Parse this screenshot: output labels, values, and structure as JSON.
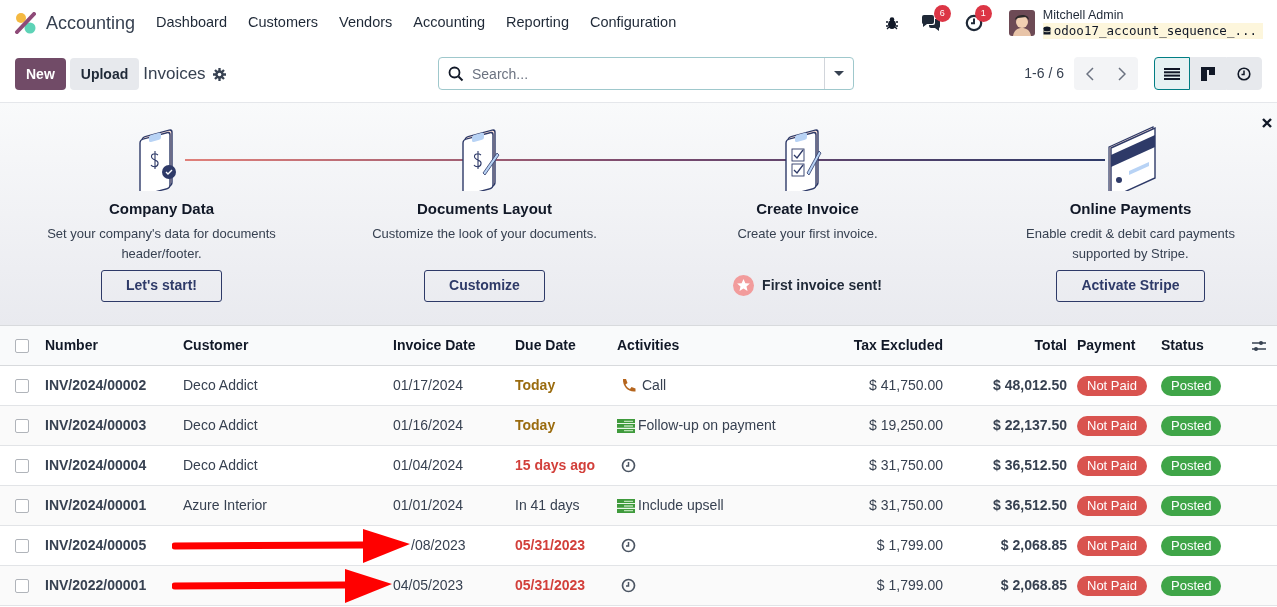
{
  "navbar": {
    "app_name": "Accounting",
    "menu": [
      "Dashboard",
      "Customers",
      "Vendors",
      "Accounting",
      "Reporting",
      "Configuration"
    ],
    "messages_badge": "6",
    "activities_badge": "1",
    "user_name": "Mitchell Admin",
    "database": "odoo17_account_sequence_..."
  },
  "control_panel": {
    "new_button": "New",
    "upload_button": "Upload",
    "title": "Invoices",
    "search": {
      "placeholder": "Search..."
    },
    "pager": "1-6 / 6",
    "views": [
      {
        "kind": "list",
        "selected": true
      },
      {
        "kind": "kanban",
        "selected": false
      },
      {
        "kind": "activity",
        "selected": false
      }
    ]
  },
  "onboarding": {
    "steps": [
      {
        "kind": "company",
        "title": "Company Data",
        "description": "Set your company's data for documents header/footer.",
        "action": {
          "kind": "button",
          "label": "Let's start!"
        }
      },
      {
        "kind": "layout",
        "title": "Documents Layout",
        "description": "Customize the look of your documents.",
        "action": {
          "kind": "button",
          "label": "Customize"
        }
      },
      {
        "kind": "invoice",
        "title": "Create Invoice",
        "description": "Create your first invoice.",
        "action": {
          "kind": "done",
          "label": "First invoice sent!"
        }
      },
      {
        "kind": "payment",
        "title": "Online Payments",
        "description": "Enable credit & debit card payments supported by Stripe.",
        "action": {
          "kind": "button",
          "label": "Activate Stripe"
        }
      }
    ]
  },
  "table": {
    "select_all_checked": false,
    "columns": [
      "Number",
      "Customer",
      "Invoice Date",
      "Due Date",
      "Activities",
      "Tax Excluded",
      "Total",
      "Payment",
      "Status"
    ],
    "rows": [
      {
        "checked": false,
        "number": "INV/2024/00002",
        "customer": "Deco Addict",
        "invoice_date": "01/17/2024",
        "due": {
          "kind": "today",
          "text": "Today"
        },
        "activity": {
          "kind": "call",
          "label": "Call"
        },
        "tax_excluded": "$ 41,750.00",
        "total": "$ 48,012.50",
        "payment": "Not Paid",
        "status": "Posted",
        "redacted": false
      },
      {
        "checked": false,
        "number": "INV/2024/00003",
        "customer": "Deco Addict",
        "invoice_date": "01/16/2024",
        "due": {
          "kind": "today",
          "text": "Today"
        },
        "activity": {
          "kind": "todo",
          "label": "Follow-up on payment"
        },
        "tax_excluded": "$ 19,250.00",
        "total": "$ 22,137.50",
        "payment": "Not Paid",
        "status": "Posted",
        "redacted": false
      },
      {
        "checked": false,
        "number": "INV/2024/00004",
        "customer": "Deco Addict",
        "invoice_date": "01/04/2024",
        "due": {
          "kind": "overdue",
          "text": "15 days ago"
        },
        "activity": {
          "kind": "none"
        },
        "tax_excluded": "$ 31,750.00",
        "total": "$ 36,512.50",
        "payment": "Not Paid",
        "status": "Posted",
        "redacted": false
      },
      {
        "checked": false,
        "number": "INV/2024/00001",
        "customer": "Azure Interior",
        "invoice_date": "01/01/2024",
        "due": {
          "kind": "future",
          "text": "In 41 days"
        },
        "activity": {
          "kind": "todo",
          "label": "Include upsell"
        },
        "tax_excluded": "$ 31,750.00",
        "total": "$ 36,512.50",
        "payment": "Not Paid",
        "status": "Posted",
        "redacted": false
      },
      {
        "checked": false,
        "number": "INV/2024/00005",
        "invoice_date": "/08/2023",
        "date_covered": true,
        "due": {
          "kind": "overdue",
          "text": "05/31/2023"
        },
        "activity": {
          "kind": "none"
        },
        "tax_excluded": "$ 1,799.00",
        "total": "$ 2,068.85",
        "payment": "Not Paid",
        "status": "Posted",
        "redacted": true
      },
      {
        "checked": false,
        "number": "INV/2022/00001",
        "invoice_date": "04/05/2023",
        "date_covered": false,
        "due": {
          "kind": "overdue",
          "text": "05/31/2023"
        },
        "activity": {
          "kind": "none"
        },
        "tax_excluded": "$ 1,799.00",
        "total": "$ 2,068.85",
        "payment": "Not Paid",
        "status": "Posted",
        "redacted": true
      }
    ]
  }
}
